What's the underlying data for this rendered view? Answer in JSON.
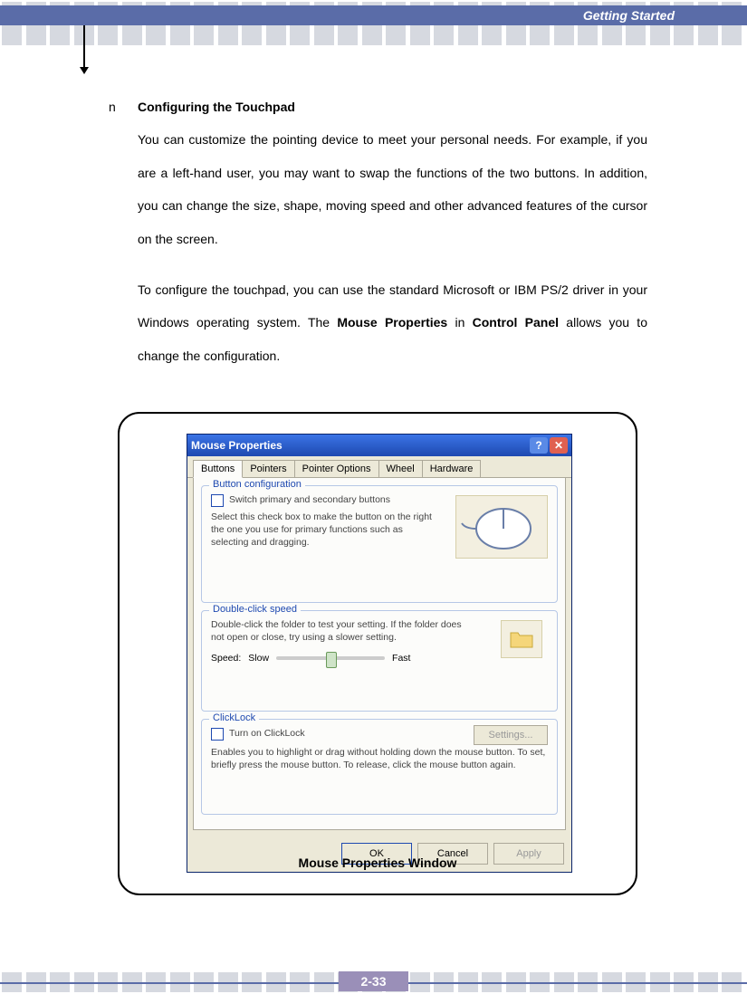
{
  "header": {
    "title": "Getting Started"
  },
  "content": {
    "bullet": "n",
    "heading": "Configuring the Touchpad",
    "p1": "You can customize the pointing device to meet your personal needs.   For example, if you are a left-hand user, you may want to swap the functions of the two buttons.   In addition, you can change the size, shape, moving speed and other advanced features of the cursor on the screen.",
    "p2a": "To configure the touchpad, you can use the standard Microsoft or IBM PS/2 driver in your Windows operating system.  The ",
    "p2b": "Mouse Properties",
    "p2c": " in ",
    "p2d": "Control Panel",
    "p2e": " allows you to change the configuration."
  },
  "dialog": {
    "title": "Mouse Properties",
    "tabs": [
      "Buttons",
      "Pointers",
      "Pointer Options",
      "Wheel",
      "Hardware"
    ],
    "g1": {
      "title": "Button configuration",
      "chk": "Switch primary and secondary buttons",
      "desc": "Select this check box to make the button on the right the one you use for primary functions such as selecting and dragging."
    },
    "g2": {
      "title": "Double-click speed",
      "desc": "Double-click the folder to test your setting. If the folder does not open or close, try using a slower setting.",
      "speed": "Speed:",
      "slow": "Slow",
      "fast": "Fast"
    },
    "g3": {
      "title": "ClickLock",
      "chk": "Turn on ClickLock",
      "settings": "Settings...",
      "desc": "Enables you to highlight or drag without holding down the mouse button. To set, briefly press the mouse button. To release, click the mouse button again."
    },
    "buttons": {
      "ok": "OK",
      "cancel": "Cancel",
      "apply": "Apply"
    }
  },
  "caption": "Mouse Properties Window",
  "pagenum": "2-33"
}
